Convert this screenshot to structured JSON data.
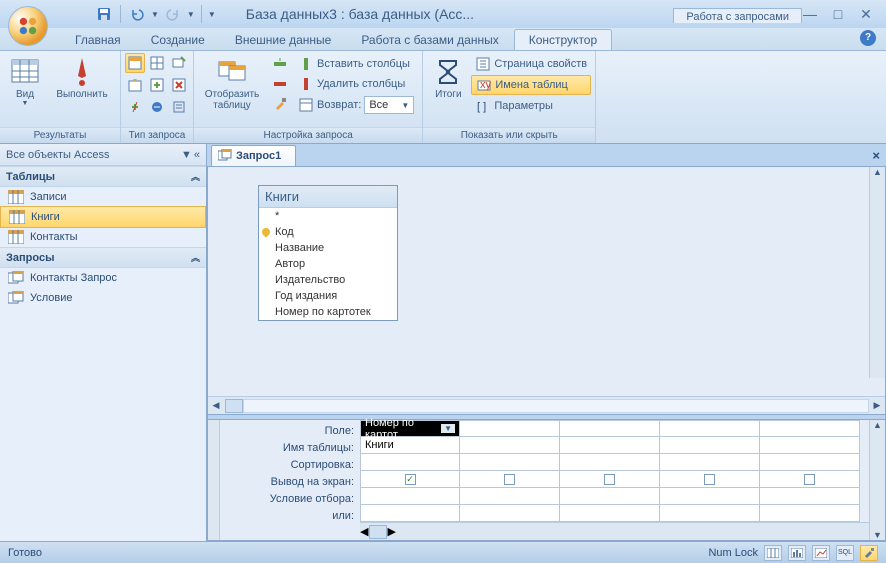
{
  "titlebar": {
    "title": "База данных3 : база данных (Acc...",
    "context_tab": "Работа с запросами"
  },
  "tabs": {
    "items": [
      "Главная",
      "Создание",
      "Внешние данные",
      "Работа с базами данных",
      "Конструктор"
    ],
    "active_index": 4
  },
  "ribbon": {
    "results": {
      "view": "Вид",
      "run": "Выполнить",
      "label": "Результаты"
    },
    "query_type": {
      "label": "Тип запроса"
    },
    "setup": {
      "show_table": "Отобразить\nтаблицу",
      "insert_cols": "Вставить столбцы",
      "delete_cols": "Удалить столбцы",
      "return": "Возврат:",
      "return_value": "Все",
      "label": "Настройка запроса"
    },
    "show_hide": {
      "totals": "Итоги",
      "property_sheet": "Страница свойств",
      "table_names": "Имена таблиц",
      "parameters": "Параметры",
      "label": "Показать или скрыть"
    }
  },
  "nav": {
    "header": "Все объекты Access",
    "groups": [
      {
        "title": "Таблицы",
        "items": [
          "Записи",
          "Книги",
          "Контакты"
        ],
        "selected": 1
      },
      {
        "title": "Запросы",
        "items": [
          "Контакты Запрос",
          "Условие"
        ],
        "selected": -1
      }
    ]
  },
  "doc": {
    "tab": "Запрос1",
    "table_box": {
      "title": "Книги",
      "fields": [
        "*",
        "Код",
        "Название",
        "Автор",
        "Издательство",
        "Год издания",
        "Номер по картотек"
      ],
      "key_index": 1
    }
  },
  "design_grid": {
    "labels": [
      "Поле:",
      "Имя таблицы:",
      "Сортировка:",
      "Вывод на экран:",
      "Условие отбора:",
      "или:"
    ],
    "rows": {
      "field": [
        "Номер по картот",
        "",
        "",
        "",
        ""
      ],
      "table": [
        "Книги",
        "",
        "",
        "",
        ""
      ],
      "show": [
        true,
        false,
        false,
        false,
        false
      ]
    }
  },
  "status": {
    "ready": "Готово",
    "numlock": "Num Lock",
    "sql": "SQL"
  }
}
